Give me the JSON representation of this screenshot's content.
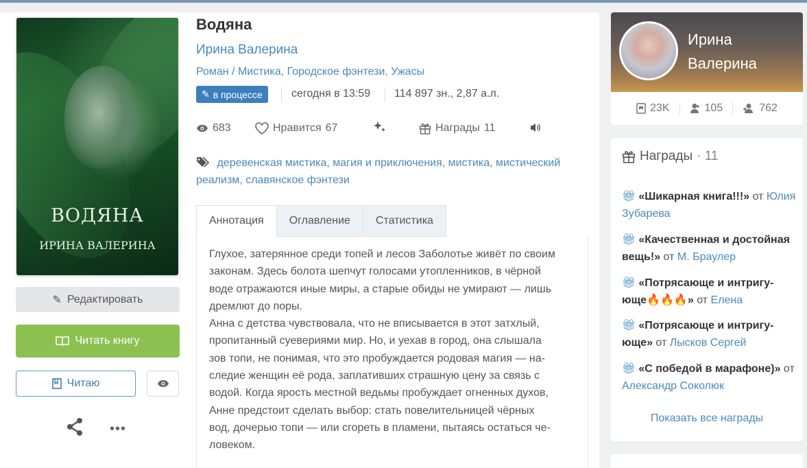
{
  "book": {
    "title": "Водяна",
    "author": "Ирина Валерина",
    "genre_type": "Роман",
    "genres": [
      "Мистика",
      "Городское фэнтези",
      "Ужасы"
    ],
    "status": "в процессе",
    "updated": "сегодня в 13:59",
    "size": "114 897 зн., 2,87 а.л.",
    "views": "683",
    "likes_label": "Нравится",
    "likes": "67",
    "awards_label": "Награды",
    "awards_count": "11",
    "tags": [
      "деревенская мистика",
      "магия и приключения",
      "мистика",
      "мистический реализм",
      "славянское фэнтези"
    ],
    "cover": {
      "title": "ВОДЯНА",
      "author": "ИРИНА ВАЛЕРИНА"
    }
  },
  "actions": {
    "edit": "Редактировать",
    "read": "Читать книгу",
    "reading": "Читаю"
  },
  "tabs": [
    "Аннотация",
    "Оглавление",
    "Статистика"
  ],
  "annotation": "Глухое, затерянное среди топей и лесов Заболотье живёт по своим\nзаконам. Здесь болота шепчут голосами утопленников, в чёрной\nводе отражаются иные миры, а старые обиды не умирают — лишь\nдремлют до поры.\nАнна с детства чувствовала, что не вписывается в этот затхлый,\nпропитанный суевериями мир. Но, и уехав в город, она слышала\nзов топи, не понимая, что это пробуждается родовая магия — на-\nследие женщин её рода, заплативших страшную цену за связь с\nводой. Когда ярость местной ведьмы пробуждает огненных духов,\nАнне предстоит сделать выбор: стать повелительницей чёрных\nвод, дочерью топи — или сгореть в пламени, пытаясь остаться че-\nловеком.",
  "author_card": {
    "name_line1": "Ирина",
    "name_line2": "Валерина",
    "books": "23K",
    "followers": "105",
    "following": "762"
  },
  "awards": {
    "title": "Награды",
    "count": "11",
    "from_word": "от",
    "items": [
      {
        "name": "«Шикарная книга!!!»",
        "from": "Юлия Зубарева"
      },
      {
        "name": "«Качественная и достойная вещь!»",
        "from": "М. Браулер"
      },
      {
        "name": "«Потрясающе и интригу-юще🔥🔥🔥»",
        "from": "Елена"
      },
      {
        "name": "«Потрясающе и интригу-юще»",
        "from": "Лысков Сергей"
      },
      {
        "name": "«С победой в марафоне)»",
        "from": "Александр Соколюк"
      }
    ],
    "show_all": "Показать все награды"
  },
  "colors": {
    "link": "#4a8ab9",
    "read_button": "#8cc152",
    "status_badge": "#3d7fbd"
  }
}
